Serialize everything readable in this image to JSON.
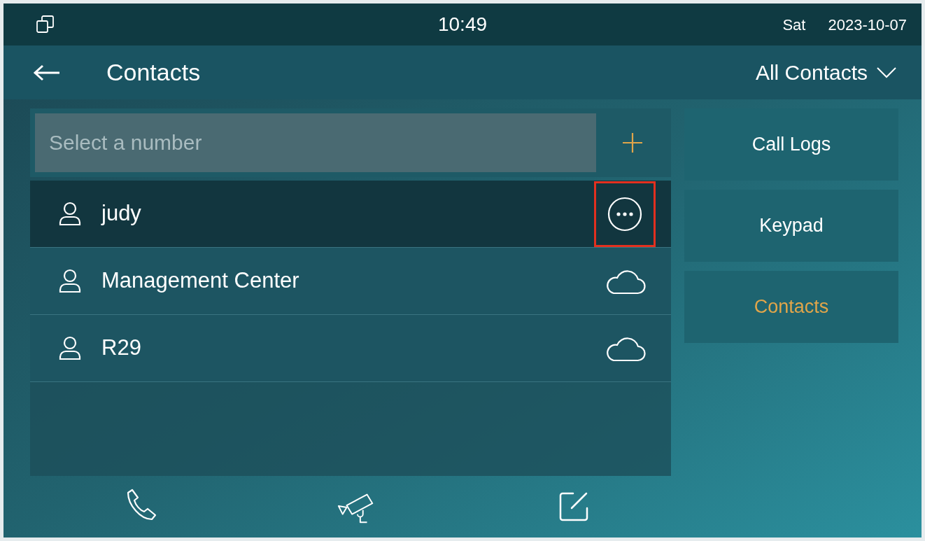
{
  "status_bar": {
    "time": "10:49",
    "day": "Sat",
    "date": "2023-10-07"
  },
  "header": {
    "title": "Contacts",
    "filter": "All Contacts"
  },
  "search": {
    "placeholder": "Select a number"
  },
  "contacts": [
    {
      "name": "judy",
      "selected": true,
      "kind": "more",
      "annotated": true
    },
    {
      "name": "Management Center",
      "selected": false,
      "kind": "cloud",
      "annotated": false
    },
    {
      "name": "R29",
      "selected": false,
      "kind": "cloud",
      "annotated": false
    }
  ],
  "side_menu": [
    {
      "label": "Call Logs",
      "selected": false
    },
    {
      "label": "Keypad",
      "selected": false
    },
    {
      "label": "Contacts",
      "selected": true
    }
  ],
  "bottom_bar": [
    {
      "kind": "phone"
    },
    {
      "kind": "camera"
    },
    {
      "kind": "edit"
    }
  ]
}
